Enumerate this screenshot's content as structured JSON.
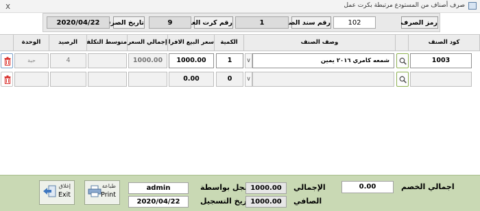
{
  "window": {
    "title": "صرف أصناف من المستودع مرتبطة بكرت عمل",
    "close_glyph": "x"
  },
  "header": {
    "disbursement_code_label": "رمز الصرف",
    "disbursement_code_value": "102",
    "voucher_no_label": "رقم سند الصرف",
    "voucher_no_value": "1",
    "job_card_label": "رقم كرت العمل",
    "job_card_value": "9",
    "date_label": "تاريخ الصرف",
    "date_value": "2020/04/22"
  },
  "grid": {
    "columns": {
      "item_code": "كود الصنف",
      "description": "وصف الصنف",
      "quantity": "الكمية",
      "unit_price": "سعر البيع الافرادي",
      "total_price": "إجمالي السعر",
      "avg_cost": "متوسط التكلفة",
      "balance": "الرصيد",
      "unit": "الوحدة"
    },
    "rows": [
      {
        "item_code": "1003",
        "description": "شمعه كامري ٢٠١٦ يمين",
        "quantity": "1",
        "unit_price": "1000.00",
        "total_price": "1000.00",
        "avg_cost": "",
        "balance": "4",
        "unit": "حبة"
      },
      {
        "item_code": "",
        "description": "",
        "quantity": "0",
        "unit_price": "0.00",
        "total_price": "",
        "avg_cost": "",
        "balance": "",
        "unit": ""
      }
    ]
  },
  "footer": {
    "exit_ar": "إغلاق",
    "exit_en": "Exit",
    "print_ar": "طباعة",
    "print_en": "Print",
    "user_value": "admin",
    "recorded_by_label": "سجل بواسطة",
    "record_date_value": "2020/04/22",
    "record_date_label": "تاريخ التسجيل",
    "total_value": "1000.00",
    "total_label": "الإجمالي",
    "net_value": "1000.00",
    "net_label": "الصافي",
    "discount_total_value": "0.00",
    "discount_total_label": "اجمالي الخصم"
  },
  "colors": {
    "footer_bg": "#c9d9b4",
    "search_border": "#8cb050",
    "delete_icon": "#d9322e"
  },
  "icons": [
    "window-icon",
    "close-icon",
    "search-icon",
    "dropdown-arrow-icon",
    "trash-icon",
    "exit-icon",
    "printer-icon"
  ]
}
